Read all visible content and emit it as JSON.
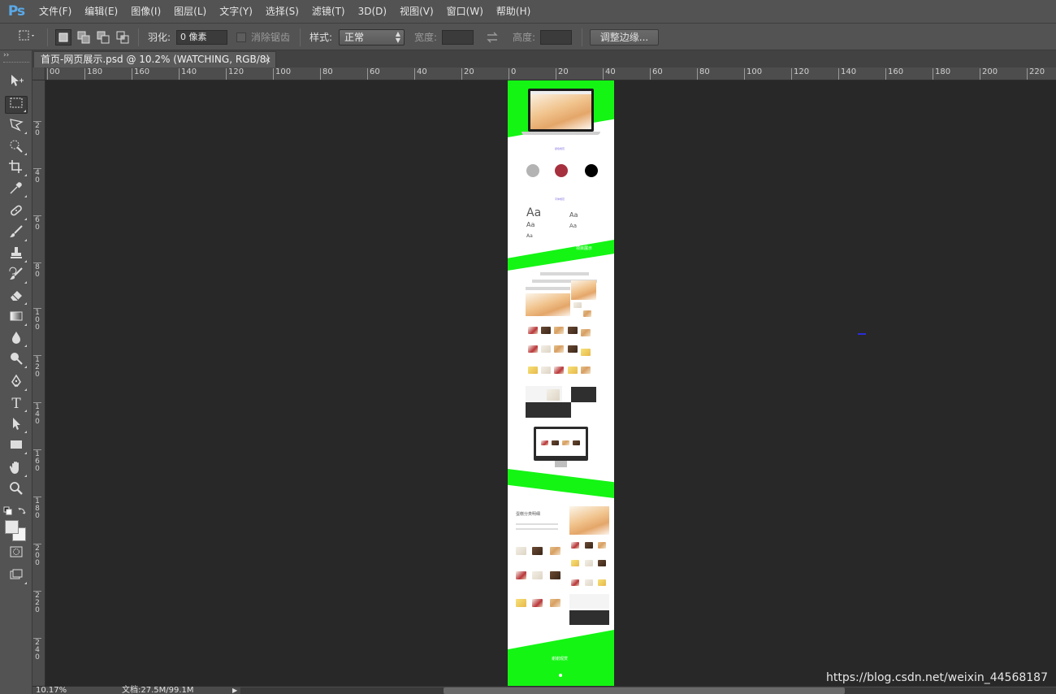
{
  "app": {
    "logo": "Ps"
  },
  "menu": [
    "文件(F)",
    "编辑(E)",
    "图像(I)",
    "图层(L)",
    "文字(Y)",
    "选择(S)",
    "滤镜(T)",
    "3D(D)",
    "视图(V)",
    "窗口(W)",
    "帮助(H)"
  ],
  "options": {
    "feather_label": "羽化:",
    "feather_value": "0 像素",
    "antialias_label": "消除锯齿",
    "style_label": "样式:",
    "style_value": "正常",
    "width_label": "宽度:",
    "height_label": "高度:",
    "refine_button": "调整边缘..."
  },
  "document": {
    "tab_title": "首页-网页展示.psd @ 10.2% (WATCHING, RGB/8)",
    "close": "×",
    "zoom": "10.17%",
    "doc_size": "文档:27.5M/99.1M",
    "mockup": {
      "section1_title": "颜色规范",
      "section2_title": "字体规范",
      "type_sample_large": "Aa",
      "type_sample_small": "Aa",
      "band1_label": "项目展示",
      "section3_title": "蛋糕分类明细",
      "footer_label": "谢谢观赏"
    }
  },
  "rulers": {
    "horizontal": [
      "00",
      "180",
      "160",
      "140",
      "120",
      "100",
      "80",
      "60",
      "40",
      "20",
      "0",
      "20",
      "40",
      "60",
      "80",
      "100",
      "120",
      "140",
      "160",
      "180",
      "200",
      "220"
    ],
    "vertical": [
      "2 0",
      "4 0",
      "6 0",
      "8 0",
      "1 0 0",
      "1 2 0",
      "1 4 0",
      "1 6 0",
      "1 8 0",
      "2 0 0",
      "2 2 0",
      "2 4 0"
    ]
  },
  "colors": {
    "accent_green": "#14f514",
    "ps_blue": "#5aa9e8",
    "swatch_gray": "#b3b3b3",
    "swatch_red": "#a6303e",
    "swatch_black": "#000000"
  },
  "watermark": "https://blog.csdn.net/weixin_44568187"
}
